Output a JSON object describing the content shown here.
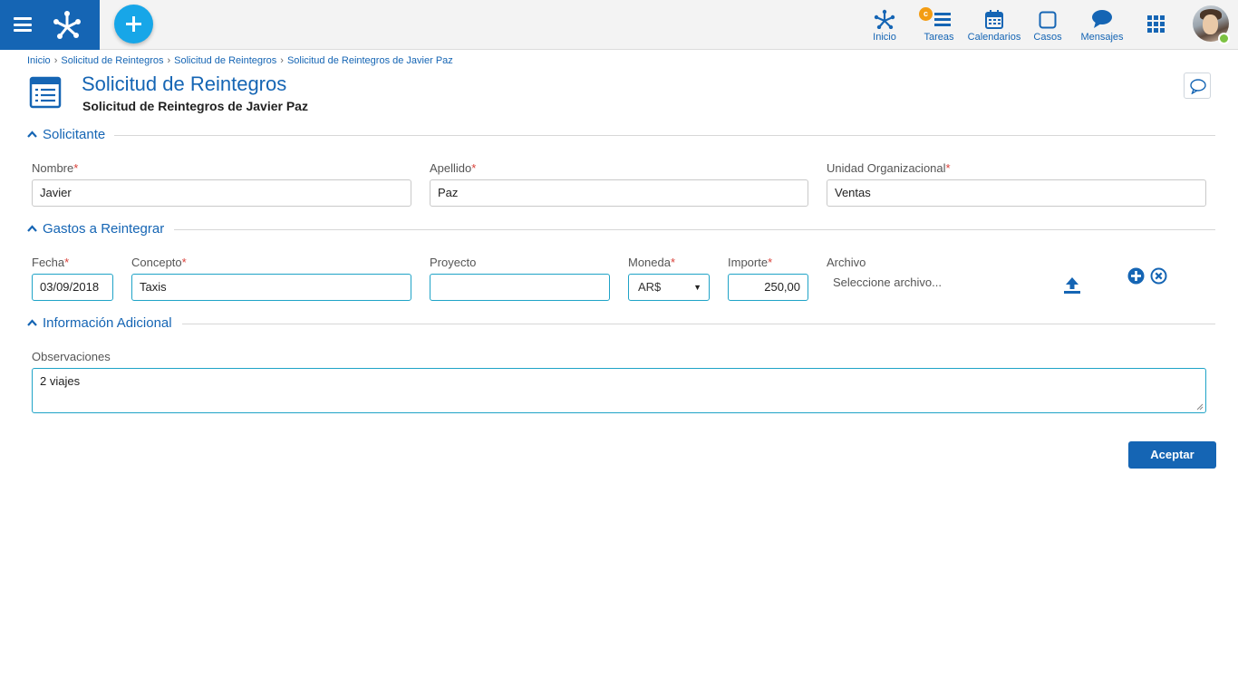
{
  "topbar": {
    "nav": [
      {
        "label": "Inicio",
        "icon": "network-icon"
      },
      {
        "label": "Tareas",
        "icon": "tasks-icon",
        "badge": "c"
      },
      {
        "label": "Calendarios",
        "icon": "calendar-icon"
      },
      {
        "label": "Casos",
        "icon": "case-icon"
      },
      {
        "label": "Mensajes",
        "icon": "message-icon"
      }
    ],
    "presence_color": "#7dc242",
    "accent": "#1565b4",
    "fab_color": "#17a6e8"
  },
  "breadcrumb": [
    "Inicio",
    "Solicitud de Reintegros",
    "Solicitud de Reintegros",
    "Solicitud de Reintegros de Javier Paz"
  ],
  "header": {
    "title": "Solicitud de Reintegros",
    "subtitle": "Solicitud de Reintegros de Javier Paz"
  },
  "sections": {
    "solicitante": {
      "label": "Solicitante",
      "nombre": {
        "label": "Nombre",
        "value": "Javier"
      },
      "apellido": {
        "label": "Apellido",
        "value": "Paz"
      },
      "unidad": {
        "label": "Unidad Organizacional",
        "value": "Ventas"
      }
    },
    "gastos": {
      "label": "Gastos a Reintegrar",
      "fecha": {
        "label": "Fecha",
        "value": "03/09/2018"
      },
      "concepto": {
        "label": "Concepto",
        "value": "Taxis"
      },
      "proyecto": {
        "label": "Proyecto",
        "value": ""
      },
      "moneda": {
        "label": "Moneda",
        "value": "AR$"
      },
      "importe": {
        "label": "Importe",
        "value": "250,00"
      },
      "archivo": {
        "label": "Archivo",
        "value": "Seleccione archivo..."
      }
    },
    "adicional": {
      "label": "Información Adicional",
      "observaciones": {
        "label": "Observaciones",
        "value": "2 viajes"
      }
    }
  },
  "required_mark": "*",
  "accept_label": "Aceptar"
}
